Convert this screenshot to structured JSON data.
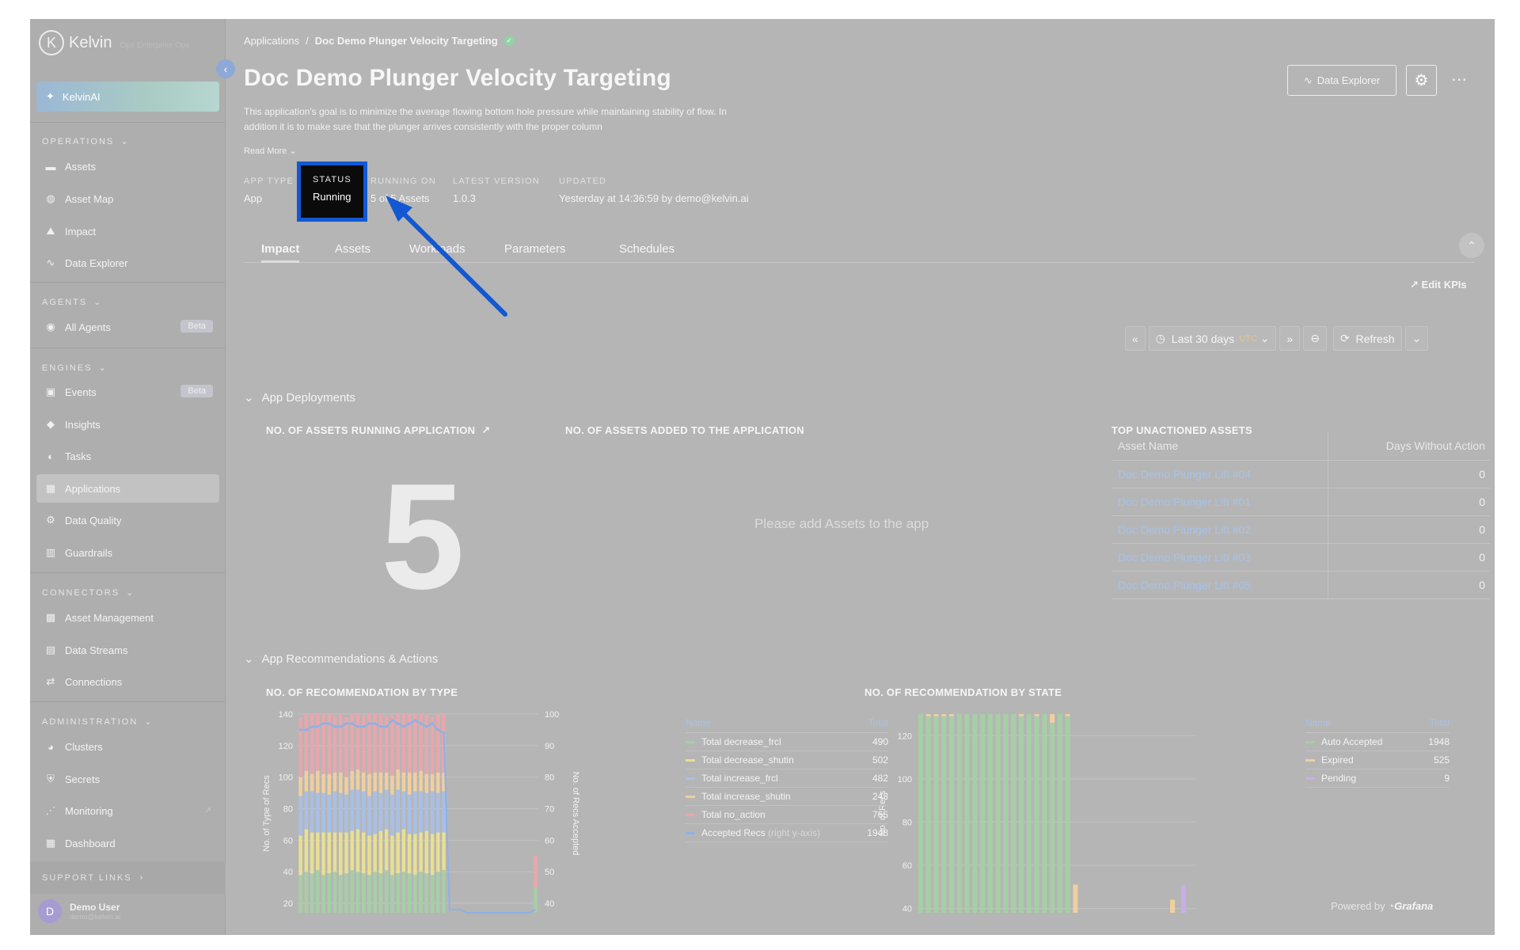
{
  "brand": {
    "logo_text": "Kelvin",
    "logo_sub": "Ops Enterprise Ops"
  },
  "sidebar": {
    "kelvin_ai": "KelvinAI",
    "sections": {
      "operations": "OPERATIONS",
      "agents": "AGENTS",
      "engines": "ENGINES",
      "connectors": "CONNECTORS",
      "administration": "ADMINISTRATION",
      "support": "SUPPORT LINKS"
    },
    "items": {
      "assets": "Assets",
      "asset_map": "Asset Map",
      "impact": "Impact",
      "data_explorer": "Data Explorer",
      "all_agents": "All Agents",
      "events": "Events",
      "insights": "Insights",
      "tasks": "Tasks",
      "applications": "Applications",
      "data_quality": "Data Quality",
      "guardrails": "Guardrails",
      "asset_management": "Asset Management",
      "data_streams": "Data Streams",
      "connections": "Connections",
      "clusters": "Clusters",
      "secrets": "Secrets",
      "monitoring": "Monitoring",
      "dashboard": "Dashboard"
    },
    "beta": "Beta",
    "user": {
      "initial": "D",
      "name": "Demo User",
      "email": "demo@kelvin.ai"
    }
  },
  "breadcrumb": {
    "parent": "Applications",
    "separator": "/",
    "current": "Doc Demo Plunger Velocity Targeting"
  },
  "page": {
    "title": "Doc Demo Plunger Velocity Targeting",
    "description": "This application's goal is to minimize the average flowing bottom hole pressure while maintaining stability of flow. In addition it is to make sure that the plunger arrives consistently with the proper column",
    "read_more": "Read More"
  },
  "meta": {
    "app_type_label": "APP TYPE",
    "app_type": "App",
    "status_label": "STATUS",
    "status": "Running",
    "running_on_label": "RUNNING ON",
    "running_on": "5 of 5 Assets",
    "version_label": "LATEST VERSION",
    "version": "1.0.3",
    "updated_label": "UPDATED",
    "updated": "Yesterday at 14:36:59 by demo@kelvin.ai"
  },
  "header_buttons": {
    "data_explorer": "Data Explorer"
  },
  "tabs": [
    "Impact",
    "Assets",
    "Workloads",
    "Parameters",
    "Schedules"
  ],
  "toolbar": {
    "edit_kpis": "Edit KPIs",
    "range": "Last 30 days",
    "tz": "UTC",
    "refresh": "Refresh"
  },
  "deployments": {
    "group_title": "App Deployments",
    "running_title": "NO. OF ASSETS RUNNING APPLICATION",
    "running_value": "5",
    "added_title": "NO. OF ASSETS ADDED TO THE APPLICATION",
    "added_empty": "Please add Assets to the app",
    "top_title": "TOP UNACTIONED ASSETS",
    "table": {
      "headers": [
        "Asset Name",
        "Days Without Action"
      ],
      "rows": [
        [
          "Doc Demo Plunger Lift #04",
          "0"
        ],
        [
          "Doc Demo Plunger Lift #01",
          "0"
        ],
        [
          "Doc Demo Plunger Lift #02",
          "0"
        ],
        [
          "Doc Demo Plunger Lift #03",
          "0"
        ],
        [
          "Doc Demo Plunger Lift #05",
          "0"
        ]
      ]
    }
  },
  "recommendations": {
    "group_title": "App Recommendations & Actions",
    "by_type_title": "NO. OF RECOMMENDATION BY TYPE",
    "by_state_title": "NO. OF RECOMMENDATION BY STATE",
    "legend_name": "Name",
    "legend_total": "Total",
    "type_legend": [
      {
        "name": "Total decrease_frcl",
        "total": "490",
        "color": "#a6cfa6"
      },
      {
        "name": "Total decrease_shutin",
        "total": "502",
        "color": "#e9df92"
      },
      {
        "name": "Total increase_frcl",
        "total": "482",
        "color": "#a8c0e6"
      },
      {
        "name": "Total increase_shutin",
        "total": "243",
        "color": "#f0cf9f"
      },
      {
        "name": "Total no_action",
        "total": "765",
        "color": "#eaa6ad"
      },
      {
        "name": "Accepted Recs",
        "suffix": "(right y-axis)",
        "total": "1948",
        "color": "#8fb0e6"
      }
    ],
    "state_legend": [
      {
        "name": "Auto Accepted",
        "total": "1948",
        "color": "#a6cfa6"
      },
      {
        "name": "Expired",
        "total": "525",
        "color": "#f0cf9f"
      },
      {
        "name": "Pending",
        "total": "9",
        "color": "#c9aee6"
      }
    ],
    "type_ylabel": "No. of Type of Recs",
    "type_y2label": "No. of Recs Accepted",
    "state_ylabel": "No. of Recs"
  },
  "chart_data": [
    {
      "type": "bar",
      "title": "NO. OF RECOMMENDATION BY TYPE",
      "ylabel": "No. of Type of Recs",
      "y2label": "No. of Recs Accepted",
      "ylim": [
        14,
        140
      ],
      "y2lim": [
        37,
        100
      ],
      "yticks": [
        20,
        40,
        60,
        80,
        100,
        120,
        140
      ],
      "y2ticks": [
        40,
        50,
        60,
        70,
        80,
        90,
        100
      ],
      "series": [
        {
          "name": "Total decrease_frcl",
          "color": "#a6cfa6",
          "values": [
            24,
            26,
            25,
            27,
            24,
            25,
            26,
            24,
            25,
            27,
            26,
            25,
            24,
            26,
            25,
            27,
            24,
            25,
            26,
            25,
            24,
            26,
            25,
            24,
            26,
            27,
            0,
            0,
            0,
            0,
            0,
            0,
            0,
            0,
            0,
            0,
            0,
            0,
            0,
            0,
            0,
            16
          ]
        },
        {
          "name": "Total decrease_shutin",
          "color": "#e9df92",
          "values": [
            25,
            27,
            26,
            24,
            27,
            26,
            25,
            27,
            26,
            25,
            27,
            26,
            25,
            24,
            27,
            26,
            25,
            26,
            27,
            25,
            26,
            25,
            27,
            26,
            25,
            24,
            0,
            0,
            0,
            0,
            0,
            0,
            0,
            0,
            0,
            0,
            0,
            0,
            0,
            0,
            0,
            0
          ]
        },
        {
          "name": "Total increase_frcl",
          "color": "#a8c0e6",
          "values": [
            25,
            24,
            26,
            25,
            25,
            24,
            26,
            25,
            24,
            26,
            25,
            26,
            25,
            27,
            24,
            25,
            26,
            27,
            24,
            25,
            27,
            26,
            24,
            27,
            25,
            26,
            0,
            0,
            0,
            0,
            0,
            0,
            0,
            0,
            0,
            0,
            0,
            0,
            0,
            0,
            0,
            0
          ]
        },
        {
          "name": "Total increase_shutin",
          "color": "#f0cf9f",
          "values": [
            12,
            13,
            11,
            14,
            12,
            13,
            12,
            13,
            11,
            12,
            13,
            12,
            14,
            12,
            13,
            11,
            12,
            13,
            12,
            14,
            12,
            13,
            12,
            11,
            13,
            12,
            0,
            0,
            0,
            0,
            0,
            0,
            0,
            0,
            0,
            0,
            0,
            0,
            0,
            0,
            0,
            0
          ]
        },
        {
          "name": "Total no_action",
          "color": "#eaa6ad",
          "values": [
            38,
            36,
            40,
            37,
            39,
            38,
            36,
            40,
            38,
            37,
            39,
            36,
            38,
            37,
            40,
            36,
            38,
            39,
            37,
            38,
            40,
            37,
            38,
            36,
            39,
            38,
            0,
            0,
            0,
            0,
            0,
            0,
            0,
            0,
            0,
            0,
            0,
            0,
            0,
            0,
            0,
            20
          ]
        }
      ],
      "accepted_line": [
        95,
        95,
        96,
        96,
        97,
        97,
        96,
        96,
        97,
        97,
        96,
        96,
        97,
        97,
        96,
        96,
        98,
        97,
        96,
        97,
        98,
        97,
        96,
        97,
        95,
        94,
        38,
        38,
        38,
        37,
        37,
        37,
        37,
        37,
        37,
        37,
        37,
        37,
        37,
        37,
        37,
        38
      ]
    },
    {
      "type": "bar",
      "title": "NO. OF RECOMMENDATION BY STATE",
      "ylabel": "No. of Recs",
      "ylim": [
        38,
        130
      ],
      "yticks": [
        40,
        60,
        80,
        100,
        120
      ],
      "series": [
        {
          "name": "Auto Accepted",
          "color": "#a6cfa6",
          "values": [
            97,
            91,
            91,
            91,
            91,
            92,
            92,
            96,
            96,
            96,
            96,
            94,
            93,
            91,
            92,
            91,
            94,
            88,
            92,
            91,
            0,
            0,
            0,
            0,
            0,
            0,
            0,
            0,
            0,
            0,
            0,
            0,
            0,
            0,
            0,
            0
          ]
        },
        {
          "name": "Expired",
          "color": "#f0cf9f",
          "values": [
            26,
            27,
            27,
            27,
            27,
            27,
            27,
            28,
            33,
            31,
            27,
            29,
            30,
            28,
            32,
            36,
            32,
            28,
            34,
            28,
            13,
            0,
            0,
            0,
            0,
            0,
            0,
            0,
            0,
            0,
            0,
            0,
            0,
            0,
            0,
            0
          ]
        },
        {
          "name": "Pending",
          "color": "#c9aee6",
          "values": [
            0,
            0,
            0,
            0,
            0,
            0,
            0,
            0,
            0,
            0,
            0,
            0,
            0,
            0,
            0,
            0,
            0,
            0,
            0,
            0,
            0,
            0,
            0,
            0,
            0,
            0,
            0,
            0,
            0,
            0,
            0,
            0,
            0,
            0,
            0,
            0
          ]
        }
      ],
      "tail": {
        "expired": [
          44
        ],
        "pending": [
          51
        ]
      }
    }
  ],
  "footer": {
    "powered": "Powered by",
    "brand": "Grafana"
  }
}
